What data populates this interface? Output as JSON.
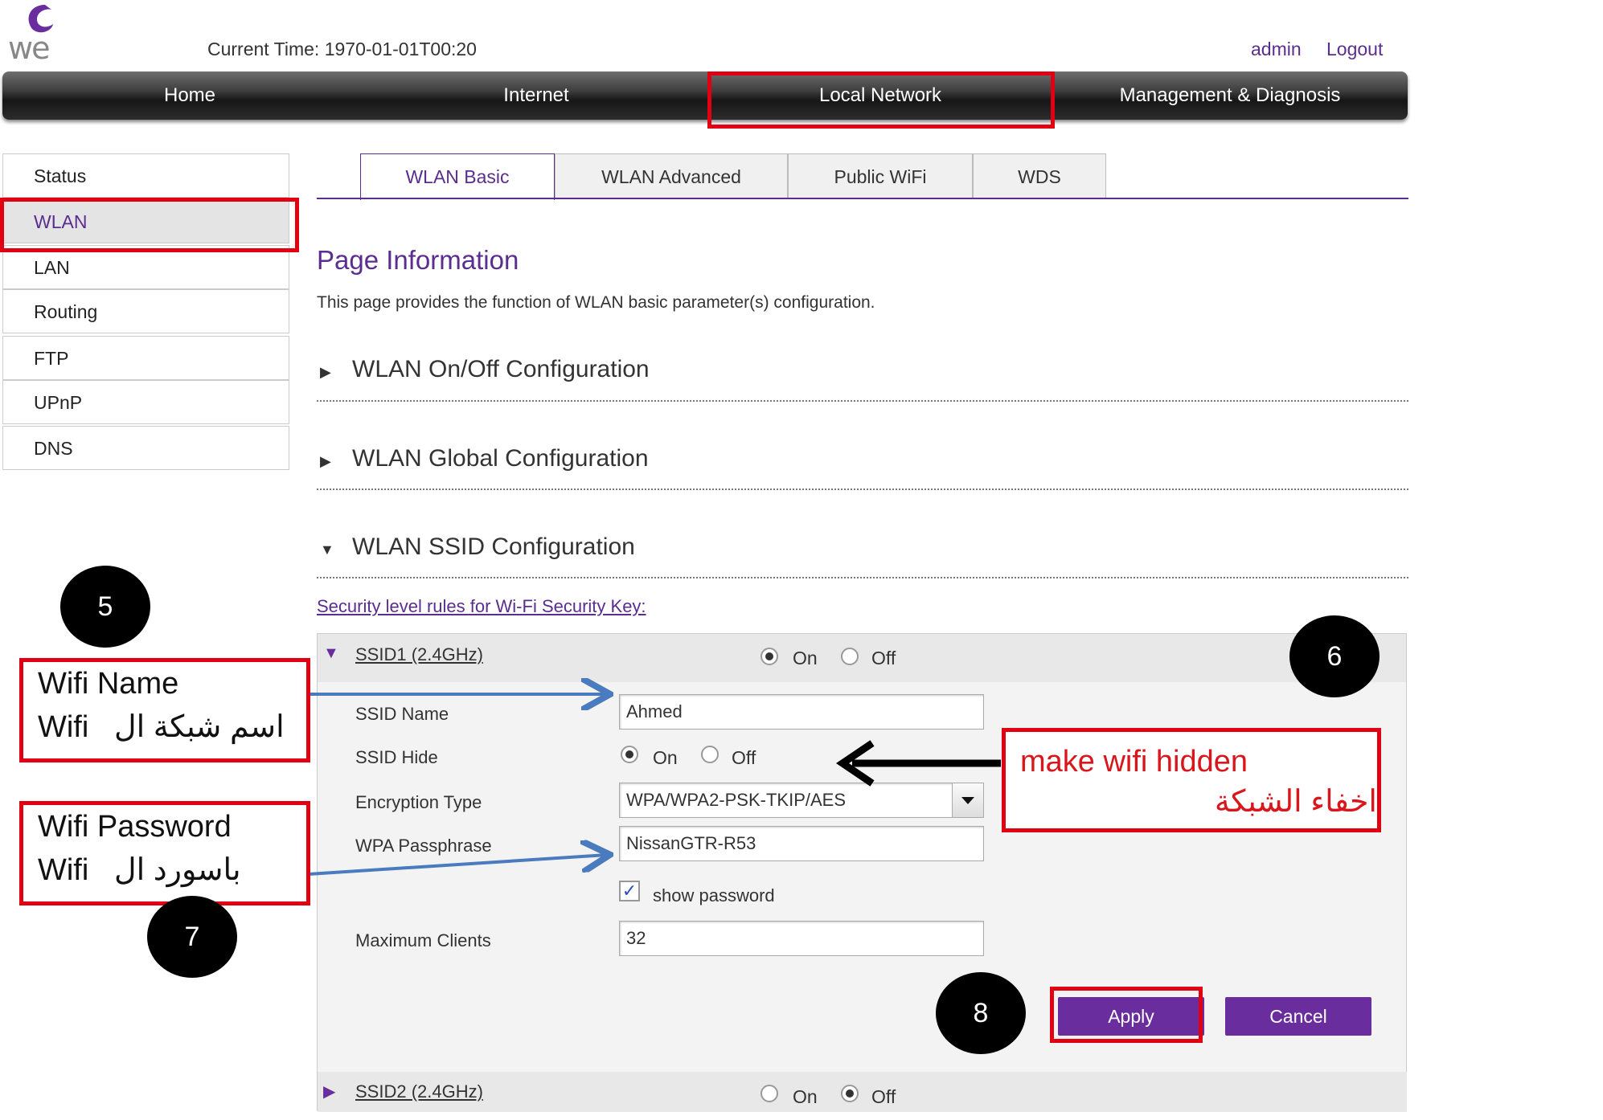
{
  "header": {
    "logo_text": "we",
    "current_time": "Current Time: 1970-01-01T00:20",
    "user": "admin",
    "logout": "Logout"
  },
  "nav": {
    "items": [
      "Home",
      "Internet",
      "Local Network",
      "Management & Diagnosis"
    ]
  },
  "sidebar": {
    "items": [
      "Status",
      "WLAN",
      "LAN",
      "Routing",
      "FTP",
      "UPnP",
      "DNS"
    ]
  },
  "tabs": [
    "WLAN Basic",
    "WLAN Advanced",
    "Public WiFi",
    "WDS"
  ],
  "page": {
    "title": "Page Information",
    "description": "This page provides the function of WLAN basic parameter(s) configuration.",
    "sections": [
      "WLAN On/Off Configuration",
      "WLAN Global Configuration",
      "WLAN SSID Configuration"
    ],
    "security_link": "Security level rules for Wi-Fi Security Key:"
  },
  "ssid1": {
    "title": "SSID1 (2.4GHz)",
    "on_label": "On",
    "off_label": "Off",
    "selected": "On",
    "fields": {
      "ssid_name_label": "SSID Name",
      "ssid_name_value": "Ahmed",
      "ssid_hide_label": "SSID Hide",
      "ssid_hide_on": "On",
      "ssid_hide_off": "Off",
      "ssid_hide_selected": "On",
      "encryption_label": "Encryption Type",
      "encryption_value": "WPA/WPA2-PSK-TKIP/AES",
      "passphrase_label": "WPA Passphrase",
      "passphrase_value": "NissanGTR-R53",
      "show_password_label": "show password",
      "show_password_checked": true,
      "max_clients_label": "Maximum Clients",
      "max_clients_value": "32"
    },
    "apply": "Apply",
    "cancel": "Cancel"
  },
  "ssid2": {
    "title": "SSID2 (2.4GHz)",
    "on_label": "On",
    "off_label": "Off",
    "selected": "Off"
  },
  "annotations": {
    "wifi_name_en": "Wifi Name",
    "wifi_name_ar": "اسم شبكة ال",
    "wifi_name_wifi": "Wifi",
    "wifi_password_en": "Wifi Password",
    "wifi_password_ar": "باسورد ال",
    "wifi_password_wifi": "Wifi",
    "hidden_en": "make wifi hidden",
    "hidden_ar": "اخفاء الشبكة",
    "badges": [
      "5",
      "6",
      "7",
      "8"
    ]
  },
  "colors": {
    "accent": "#5b2d8e",
    "button": "#6a2d9e",
    "highlight": "#e00012",
    "arrow_blue": "#4a7bbf"
  }
}
